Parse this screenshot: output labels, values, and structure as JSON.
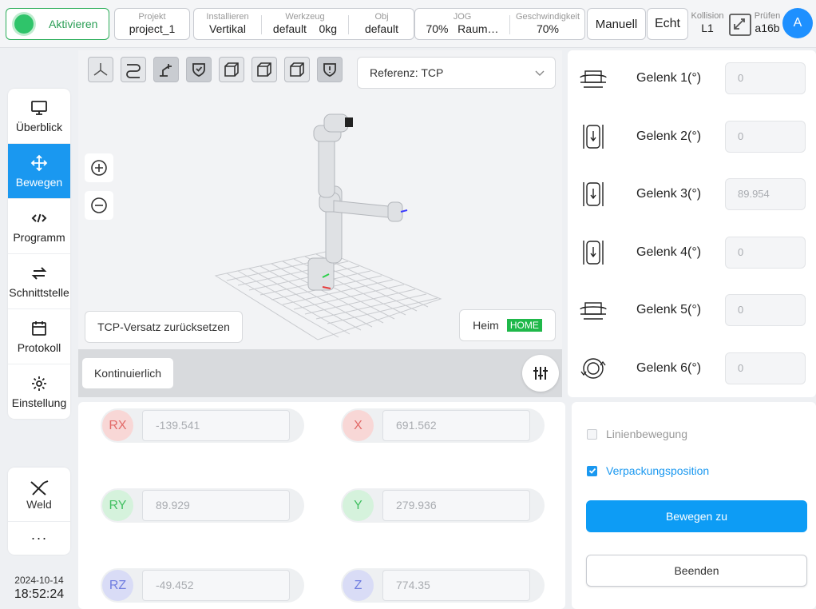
{
  "topbar": {
    "activate_label": "Aktivieren",
    "project": {
      "caption": "Projekt",
      "value": "project_1"
    },
    "install": {
      "caption": "Installieren",
      "value": "Vertikal"
    },
    "tool": {
      "caption": "Werkzeug",
      "value": "default",
      "load": "0kg"
    },
    "obj": {
      "caption": "Obj",
      "value": "default"
    },
    "jog": {
      "caption": "JOG",
      "value": "70%",
      "mode": "Raum…"
    },
    "speed": {
      "caption": "Geschwindigkeit",
      "value": "70%"
    },
    "manual_label": "Manuell",
    "real_label": "Echt",
    "collision": {
      "caption": "Kollision",
      "value": "L1"
    },
    "check": {
      "caption": "Prüfen",
      "value": "a16b"
    },
    "avatar_letter": "A"
  },
  "sidebar": {
    "items": [
      {
        "label": "Überblick",
        "icon": "monitor-icon"
      },
      {
        "label": "Bewegen",
        "icon": "move-icon"
      },
      {
        "label": "Programm",
        "icon": "code-icon"
      },
      {
        "label": "Schnittstelle",
        "icon": "swap-icon"
      },
      {
        "label": "Protokoll",
        "icon": "calendar-icon"
      },
      {
        "label": "Einstellung",
        "icon": "gear-icon"
      }
    ],
    "weld_label": "Weld",
    "more_label": "···",
    "date": "2024-10-14",
    "time": "18:52:24"
  },
  "view": {
    "reference": "Referenz: TCP",
    "reset_tcp_label": "TCP-Versatz zurücksetzen",
    "home_label": "Heim",
    "home_badge": "HOME",
    "continuous_label": "Kontinuierlich"
  },
  "joints": [
    {
      "label": "Gelenk 1(°)",
      "value": "0"
    },
    {
      "label": "Gelenk 2(°)",
      "value": "0"
    },
    {
      "label": "Gelenk 3(°)",
      "value": "89.954"
    },
    {
      "label": "Gelenk 4(°)",
      "value": "0"
    },
    {
      "label": "Gelenk 5(°)",
      "value": "0"
    },
    {
      "label": "Gelenk 6(°)",
      "value": "0"
    }
  ],
  "pose": {
    "rx": {
      "label": "RX",
      "value": "-139.541"
    },
    "ry": {
      "label": "RY",
      "value": "89.929"
    },
    "rz": {
      "label": "RZ",
      "value": "-49.452"
    },
    "x": {
      "label": "X",
      "value": "691.562"
    },
    "y": {
      "label": "Y",
      "value": "279.936"
    },
    "z": {
      "label": "Z",
      "value": "774.35"
    }
  },
  "action": {
    "linear_label": "Linienbewegung",
    "linear_checked": false,
    "packing_label": "Verpackungsposition",
    "packing_checked": true,
    "move_to_label": "Bewegen zu",
    "stop_label": "Beenden"
  },
  "colors": {
    "accent": "#1a98f0",
    "active_green": "#2fc46a",
    "home_green": "#1fb84a"
  }
}
